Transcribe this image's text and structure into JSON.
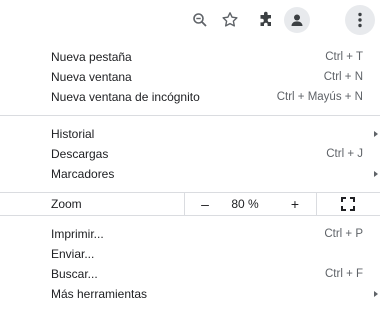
{
  "toolbar": {
    "zoom_icon": "zoom-out-icon",
    "star_icon": "star-icon",
    "extensions_icon": "puzzle-icon",
    "profile_icon": "person-icon",
    "menu_icon": "kebab-icon"
  },
  "menu": {
    "group1": [
      {
        "label": "Nueva pestaña",
        "shortcut": "Ctrl + T"
      },
      {
        "label": "Nueva ventana",
        "shortcut": "Ctrl + N"
      },
      {
        "label": "Nueva ventana de incógnito",
        "shortcut": "Ctrl + Mayús + N"
      }
    ],
    "group2": [
      {
        "label": "Historial"
      },
      {
        "label": "Descargas",
        "shortcut": "Ctrl + J"
      },
      {
        "label": "Marcadores"
      }
    ],
    "zoom": {
      "label": "Zoom",
      "minus": "–",
      "value": "80 %",
      "plus": "+"
    },
    "group3": [
      {
        "label": "Imprimir...",
        "shortcut": "Ctrl + P"
      },
      {
        "label": "Enviar..."
      },
      {
        "label": "Buscar...",
        "shortcut": "Ctrl + F"
      },
      {
        "label": "Más herramientas"
      }
    ]
  }
}
